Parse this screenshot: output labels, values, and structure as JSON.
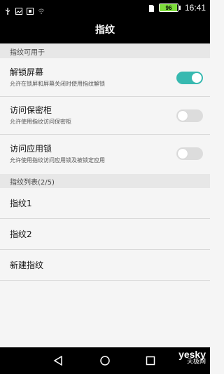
{
  "status_bar": {
    "icons_left": [
      "usb-icon",
      "image-icon",
      "screenshot-icon",
      "wifi-icon"
    ],
    "icons_right": [
      "sim-icon"
    ],
    "battery_percent": "96",
    "battery_level": 0.96,
    "time": "16:41"
  },
  "header": {
    "title": "指纹"
  },
  "section_usage": {
    "label": "指纹可用于",
    "items": [
      {
        "title": "解锁屏幕",
        "subtitle": "允许在锁屏和屏幕关闭时使用指纹解锁",
        "toggle_on": true
      },
      {
        "title": "访问保密柜",
        "subtitle": "允许使用指纹访问保密柜",
        "toggle_on": false
      },
      {
        "title": "访问应用锁",
        "subtitle": "允许使用指纹访问应用锁及被锁定应用",
        "toggle_on": false
      }
    ]
  },
  "section_list": {
    "label": "指纹列表(2/5)",
    "items": [
      {
        "title": "指纹1"
      },
      {
        "title": "指纹2"
      },
      {
        "title": "新建指纹"
      }
    ]
  },
  "nav_bar": {
    "buttons": [
      "back-icon",
      "home-icon",
      "recents-icon"
    ]
  },
  "watermark": {
    "main": "yesky",
    "sub": "天极网"
  },
  "colors": {
    "accent": "#37b9b0",
    "status_bar": "#000000",
    "background": "#f5f5f5",
    "section_header": "#e7e7e7"
  }
}
